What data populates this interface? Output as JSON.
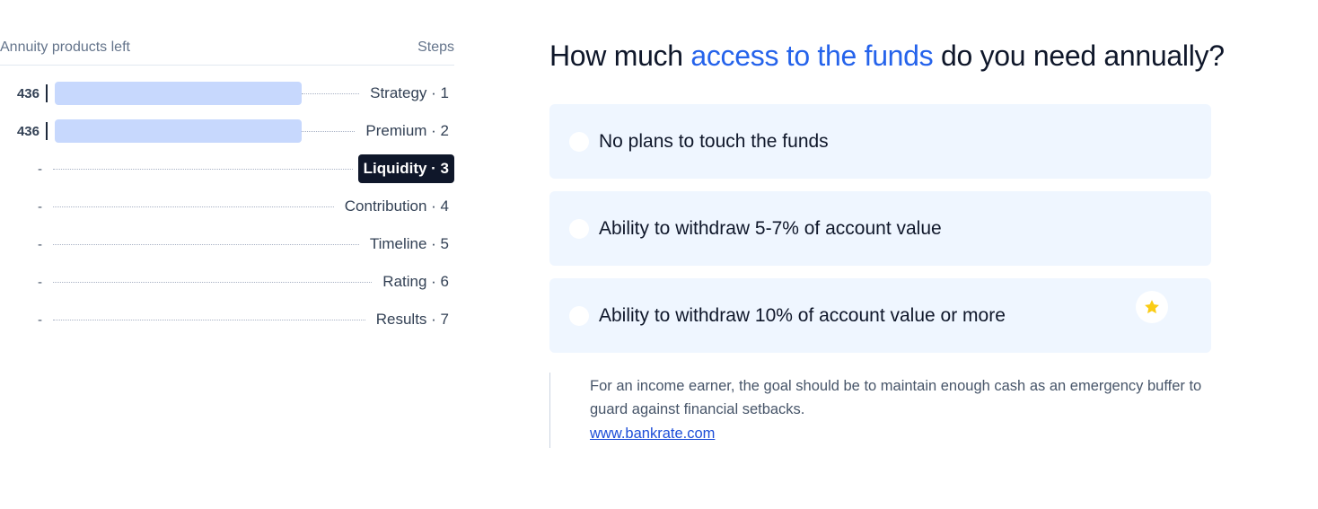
{
  "progress": {
    "header_left": "Annuity products left",
    "header_right": "Steps",
    "steps": [
      {
        "count": "436",
        "label": "Strategy · 1",
        "fill": 1.0
      },
      {
        "count": "436",
        "label": "Premium · 2",
        "fill": 1.0
      },
      {
        "count": "-",
        "label": "Liquidity · 3",
        "active": true
      },
      {
        "count": "-",
        "label": "Contribution · 4"
      },
      {
        "count": "-",
        "label": "Timeline · 5"
      },
      {
        "count": "-",
        "label": "Rating · 6"
      },
      {
        "count": "-",
        "label": "Results · 7"
      }
    ]
  },
  "question": {
    "title_prefix": "How much ",
    "title_highlight": "access to the funds",
    "title_suffix": " do you need annually?",
    "options": [
      {
        "label": "No plans to touch the funds"
      },
      {
        "label": "Ability to withdraw 5-7% of account value"
      },
      {
        "label": "Ability to withdraw 10% of account value or more",
        "badge_icon": "star-icon"
      }
    ]
  },
  "tip": {
    "text": "For an income earner, the goal should be to maintain enough cash as an emergency buffer to guard against financial setbacks.",
    "link": "www.bankrate.com"
  },
  "colors": {
    "accent": "#2563eb",
    "bar": "#c7d8fd",
    "option_bg": "#eff6ff",
    "active_step_bg": "#0f172a",
    "star": "#facc15"
  }
}
